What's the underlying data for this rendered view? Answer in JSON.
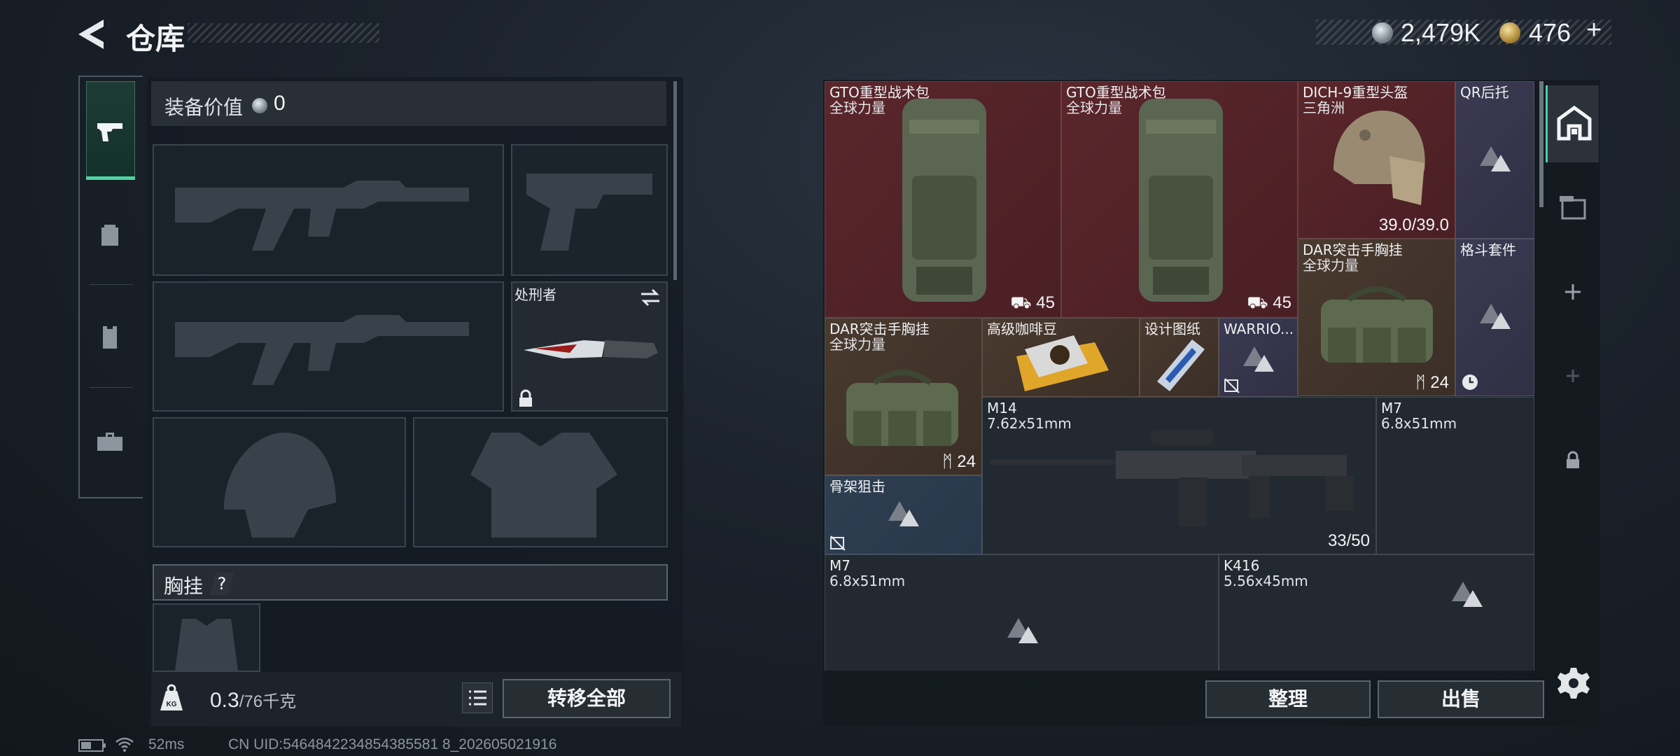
{
  "header": {
    "title": "仓库"
  },
  "currency": {
    "coin1": "2,479K",
    "coin2": "476",
    "coin2_plus": "+"
  },
  "equipment": {
    "value_label": "装备价值",
    "value": "0",
    "knife_name": "处刑者",
    "chest_label": "胸挂",
    "chest_help": "?"
  },
  "weight": {
    "current": "0.3",
    "max": "/76千克",
    "icon_text": "KG",
    "move_all": "转移全部"
  },
  "items": [
    {
      "name": "GTO重型战术包",
      "sub": "全球力量",
      "value": "45"
    },
    {
      "name": "GTO重型战术包",
      "sub": "全球力量",
      "value": "45"
    },
    {
      "name": "DICH-9重型头盔",
      "sub": "三角洲",
      "value": "39.0/39.0"
    },
    {
      "name": "QR后托",
      "sub": "",
      "value": ""
    },
    {
      "name": "DAR突击手胸挂",
      "sub": "全球力量",
      "value": "24"
    },
    {
      "name": "格斗套件",
      "sub": "",
      "value": ""
    },
    {
      "name": "DAR突击手胸挂",
      "sub": "全球力量",
      "value": "24"
    },
    {
      "name": "高级咖啡豆",
      "sub": "",
      "value": ""
    },
    {
      "name": "设计图纸",
      "sub": "",
      "value": ""
    },
    {
      "name": "WARRIO...",
      "sub": "",
      "value": ""
    },
    {
      "name": "M14",
      "sub": "7.62x51mm",
      "value": "33/50"
    },
    {
      "name": "M7",
      "sub": "6.8x51mm",
      "value": ""
    },
    {
      "name": "骨架狙击",
      "sub": "",
      "value": ""
    },
    {
      "name": "M7",
      "sub": "6.8x51mm",
      "value": ""
    },
    {
      "name": "K416",
      "sub": "5.56x45mm",
      "value": ""
    }
  ],
  "actions": {
    "sort": "整理",
    "sell": "出售"
  },
  "status": {
    "ping": "52ms",
    "uid": "CN UID:5464842234854385581 8_202605021916"
  },
  "colors": {
    "accent": "#4fd1a2",
    "rarity_red": "#5a262b",
    "rarity_purple": "#3b3a52",
    "rarity_brown": "#4a3a2f",
    "rarity_blue": "#2f3f52"
  }
}
